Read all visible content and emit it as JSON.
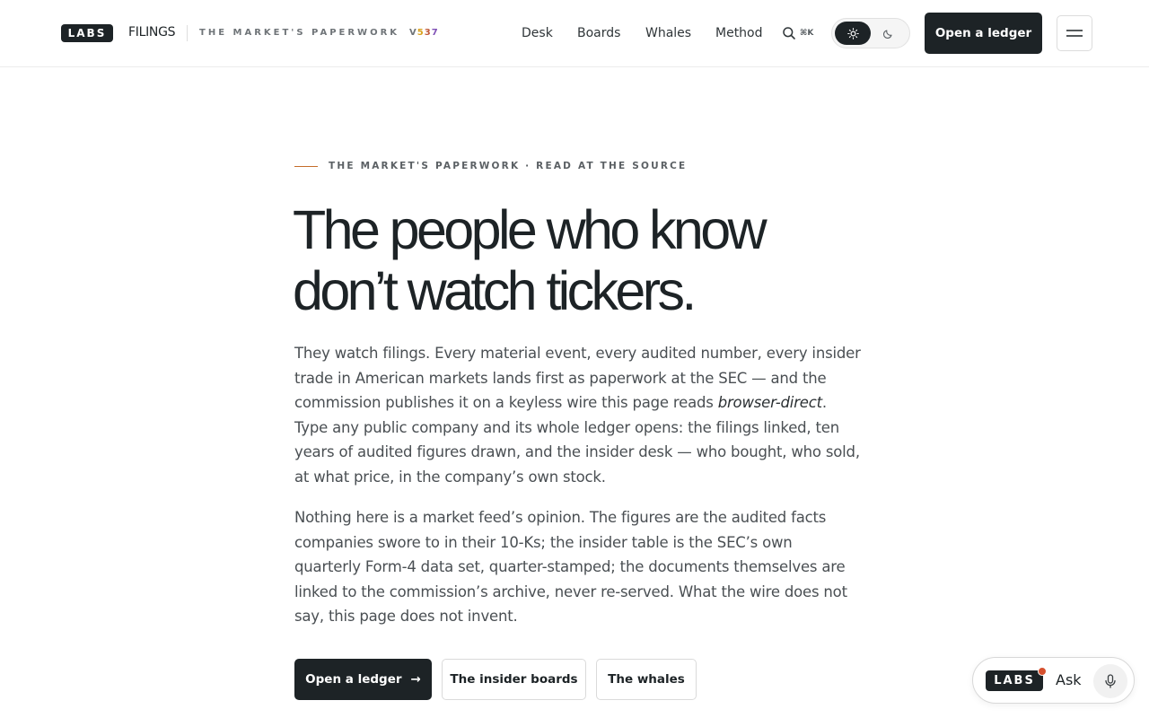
{
  "header": {
    "logo_text": "LABS",
    "brand_name": "FILINGS",
    "tagline": "THE MARKET'S PAPERWORK",
    "version_prefix": "V",
    "version_digits": [
      "5",
      "3",
      "7"
    ],
    "nav": [
      "Desk",
      "Boards",
      "Whales",
      "Method"
    ],
    "search_shortcut": "⌘K",
    "theme_selected": "light",
    "cta_label": "Open a ledger",
    "icons": {
      "search": "search-icon",
      "light": "sun-icon",
      "dark": "moon-icon",
      "menu": "hamburger-menu-icon"
    }
  },
  "hero": {
    "eyebrow": "THE MARKET'S PAPERWORK · READ AT THE SOURCE",
    "headline_line1": "The people who know",
    "headline_line2": "don’t watch tickers.",
    "p1_before": "They watch filings. Every material event, every audited number, every insider trade in American markets lands first as paperwork at the SEC — and the commission publishes it on a keyless wire this page reads ",
    "p1_em": "browser-direct",
    "p1_after": ". Type any public company and its whole ledger opens: the filings linked, ten years of audited figures drawn, and the insider desk — who bought, who sold, at what price, in the company’s own stock.",
    "p2": "Nothing here is a market feed’s opinion. The figures are the audited facts companies swore to in their 10-Ks; the insider table is the SEC’s own quarterly Form-4 data set, quarter-stamped; the documents themselves are linked to the commission’s archive, never re-served. What the wire does not say, this page does not invent.",
    "buttons": {
      "primary": "Open a ledger",
      "primary_arrow": "→",
      "insider_boards": "The insider boards",
      "whales": "The whales"
    }
  },
  "ask_widget": {
    "logo_text": "LABS",
    "label": "Ask",
    "icon": "microphone-icon"
  },
  "colors": {
    "ink": "#1d2326",
    "accent_line": "#c46d2a",
    "notification_dot": "#d6502e"
  }
}
